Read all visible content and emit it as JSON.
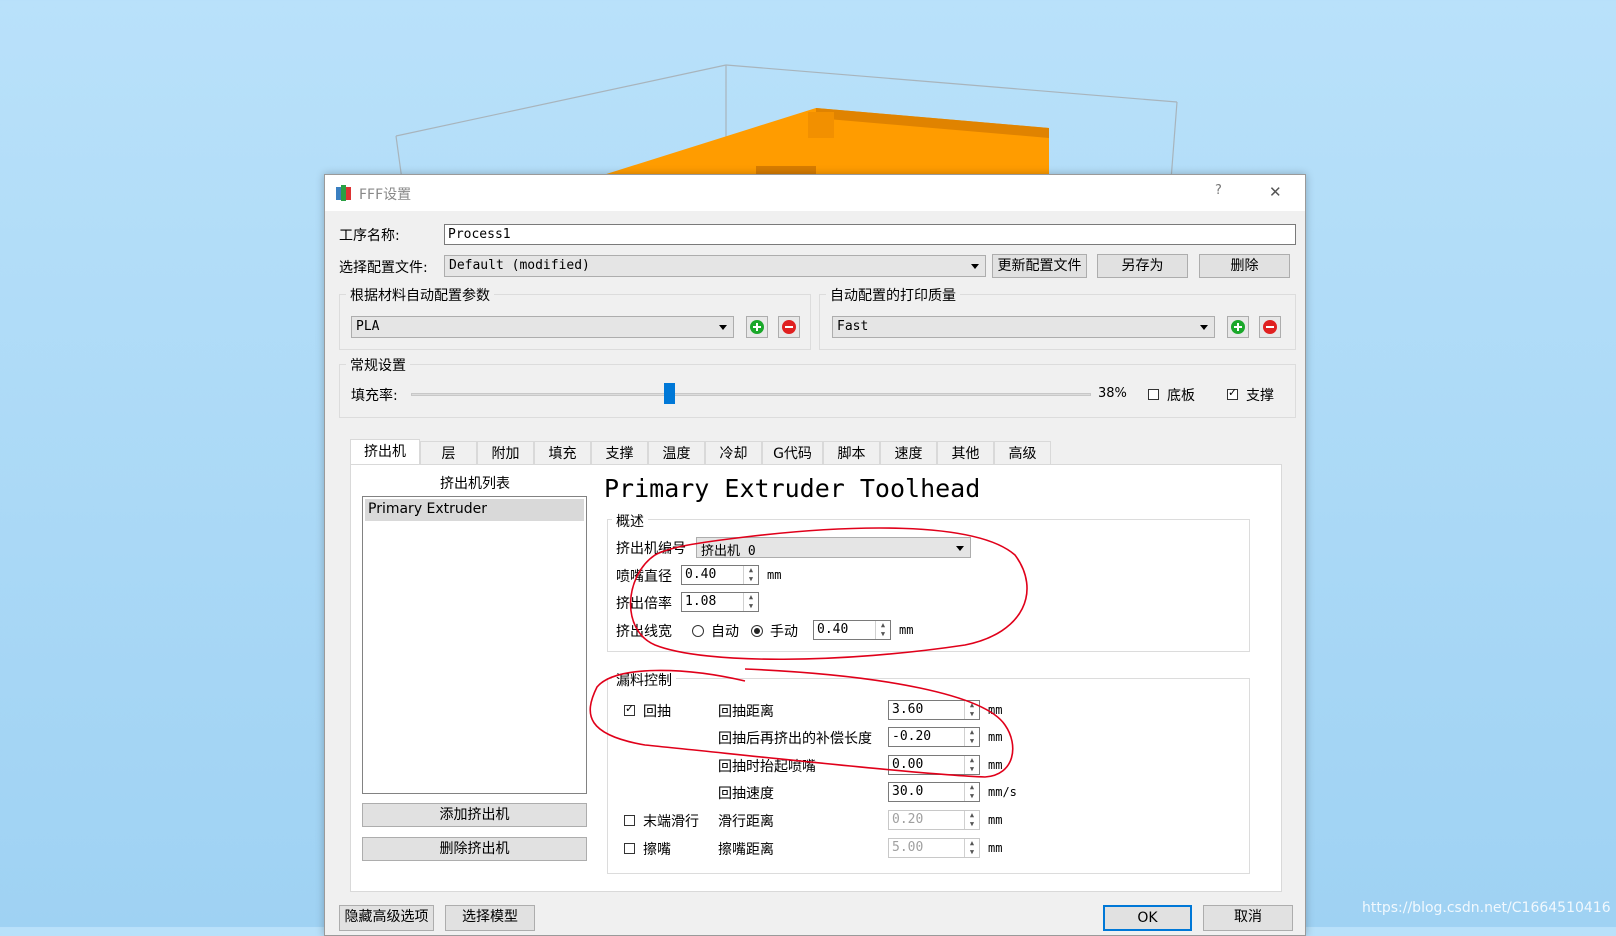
{
  "dialog": {
    "title": "FFF设置",
    "help_label": "?",
    "close_label": "✕"
  },
  "top": {
    "process_name_label": "工序名称:",
    "process_name_value": "Process1",
    "profile_label": "选择配置文件:",
    "profile_value": "Default (modified)",
    "update_profile_label": "更新配置文件",
    "save_as_label": "另存为",
    "delete_label": "删除"
  },
  "material_group": {
    "title": "根据材料自动配置参数",
    "value": "PLA"
  },
  "quality_group": {
    "title": "自动配置的打印质量",
    "value": "Fast"
  },
  "general_group": {
    "title": "常规设置",
    "infill_label": "填充率:",
    "infill_percent": 38,
    "infill_text": "38%",
    "raft_label": "底板",
    "raft_checked": false,
    "support_label": "支撑",
    "support_checked": true
  },
  "tabs": [
    {
      "label": "挤出机",
      "active": true
    },
    {
      "label": "层",
      "active": false
    },
    {
      "label": "附加",
      "active": false
    },
    {
      "label": "填充",
      "active": false
    },
    {
      "label": "支撑",
      "active": false
    },
    {
      "label": "温度",
      "active": false
    },
    {
      "label": "冷却",
      "active": false
    },
    {
      "label": "G代码",
      "active": false
    },
    {
      "label": "脚本",
      "active": false
    },
    {
      "label": "速度",
      "active": false
    },
    {
      "label": "其他",
      "active": false
    },
    {
      "label": "高级",
      "active": false
    }
  ],
  "extruder_list": {
    "title": "挤出机列表",
    "items": [
      "Primary Extruder"
    ],
    "add_label": "添加挤出机",
    "remove_label": "删除挤出机"
  },
  "extruder_panel": {
    "heading": "Primary Extruder Toolhead",
    "overview": {
      "title": "概述",
      "extruder_no_label": "挤出机编号",
      "extruder_no_value": "挤出机 0",
      "nozzle_diameter_label": "喷嘴直径",
      "nozzle_diameter_value": "0.40",
      "nozzle_diameter_unit": "mm",
      "extrusion_multiplier_label": "挤出倍率",
      "extrusion_multiplier_value": "1.08",
      "extrusion_width_label": "挤出线宽",
      "auto_label": "自动",
      "manual_label": "手动",
      "extrusion_width_value": "0.40",
      "extrusion_width_unit": "mm"
    },
    "ooze": {
      "title": "漏料控制",
      "retract_label": "回抽",
      "retract_checked": true,
      "retract_distance_label": "回抽距离",
      "retract_distance_value": "3.60",
      "retract_distance_unit": "mm",
      "extra_restart_label": "回抽后再挤出的补偿长度",
      "extra_restart_value": "-0.20",
      "extra_restart_unit": "mm",
      "lift_label": "回抽时抬起喷嘴",
      "lift_value": "0.00",
      "lift_unit": "mm",
      "retract_speed_label": "回抽速度",
      "retract_speed_value": "30.0",
      "retract_speed_unit": "mm/s",
      "coast_label": "末端滑行",
      "coast_checked": false,
      "coast_distance_label": "滑行距离",
      "coast_distance_value": "0.20",
      "coast_distance_unit": "mm",
      "wipe_label": "擦嘴",
      "wipe_checked": false,
      "wipe_distance_label": "擦嘴距离",
      "wipe_distance_value": "5.00",
      "wipe_distance_unit": "mm"
    }
  },
  "bottom": {
    "hide_advanced_label": "隐藏高级选项",
    "select_model_label": "选择模型",
    "ok_label": "OK",
    "cancel_label": "取消"
  },
  "watermark": "https://blog.csdn.net/C1664510416",
  "colors": {
    "model_orange": "#ff9c00",
    "slider_blue": "#0078d7",
    "add_green": "#1aa82a",
    "remove_red": "#e02020",
    "annotation_red": "#e0001a"
  }
}
